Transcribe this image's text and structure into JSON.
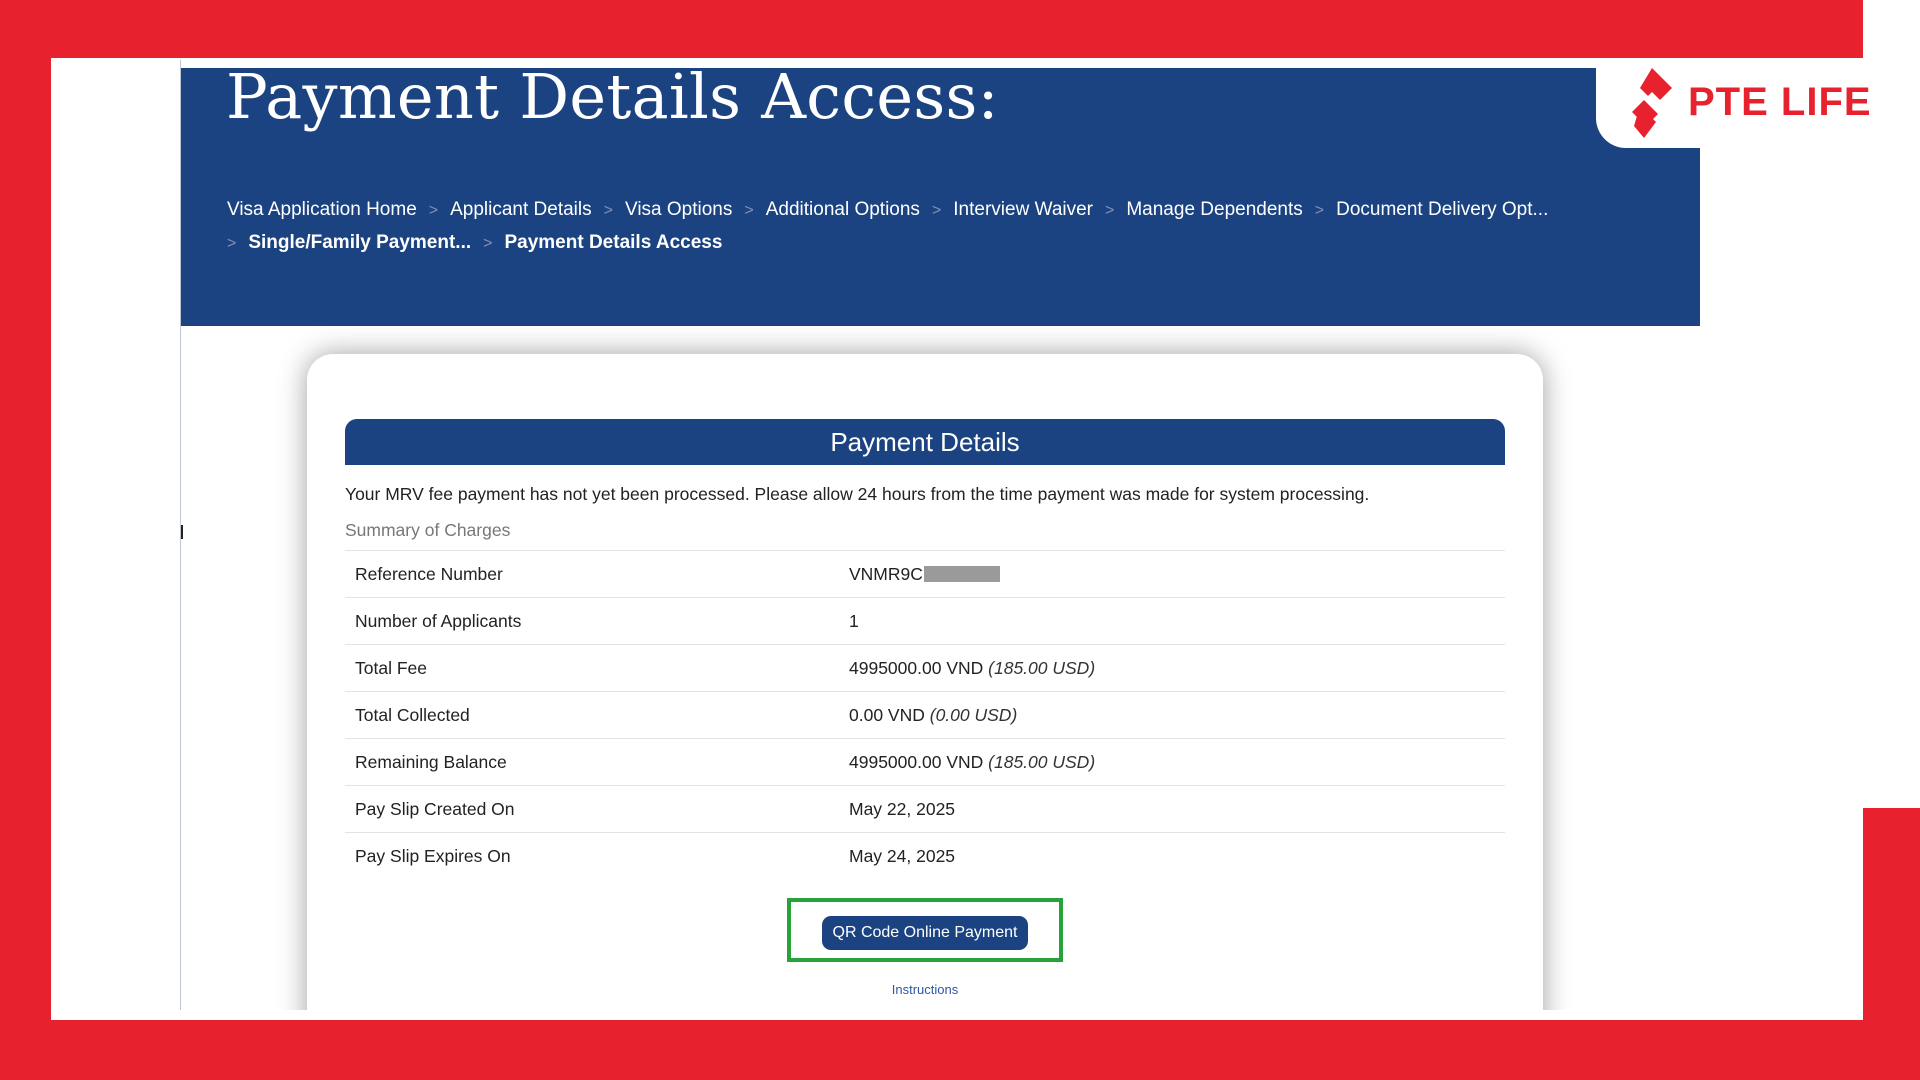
{
  "page": {
    "heading": "Payment Details Access:",
    "breadcrumb": [
      "Visa Application Home",
      "Applicant Details",
      "Visa Options",
      "Additional Options",
      "Interview Waiver",
      "Manage Dependents",
      "Document Delivery Opt...",
      "Single/Family Payment...",
      "Payment Details Access"
    ],
    "breadcrumb_separator": ">"
  },
  "card": {
    "title": "Payment Details",
    "notice": "Your MRV fee payment has not yet been processed. Please allow 24 hours from the time payment was made for system processing.",
    "summary_title": "Summary of Charges",
    "rows": [
      {
        "label": "Reference Number",
        "value": "VNMR9C",
        "note": ""
      },
      {
        "label": "Number of Applicants",
        "value": "1",
        "note": ""
      },
      {
        "label": "Total Fee",
        "value": "4995000.00 VND",
        "note": "(185.00 USD)"
      },
      {
        "label": "Total Collected",
        "value": "0.00 VND",
        "note": "(0.00 USD)"
      },
      {
        "label": "Remaining Balance",
        "value": "4995000.00 VND",
        "note": "(185.00 USD)"
      },
      {
        "label": "Pay Slip Created On",
        "value": "May 22, 2025",
        "note": ""
      },
      {
        "label": "Pay Slip Expires On",
        "value": "May 24, 2025",
        "note": ""
      }
    ],
    "qr_button": "QR Code Online Payment",
    "instructions": "Instructions"
  },
  "brand": {
    "name": "PTE LIFE",
    "color": "#e8212e"
  },
  "colors": {
    "banner": "#1c4381",
    "highlight": "#27a33a"
  }
}
